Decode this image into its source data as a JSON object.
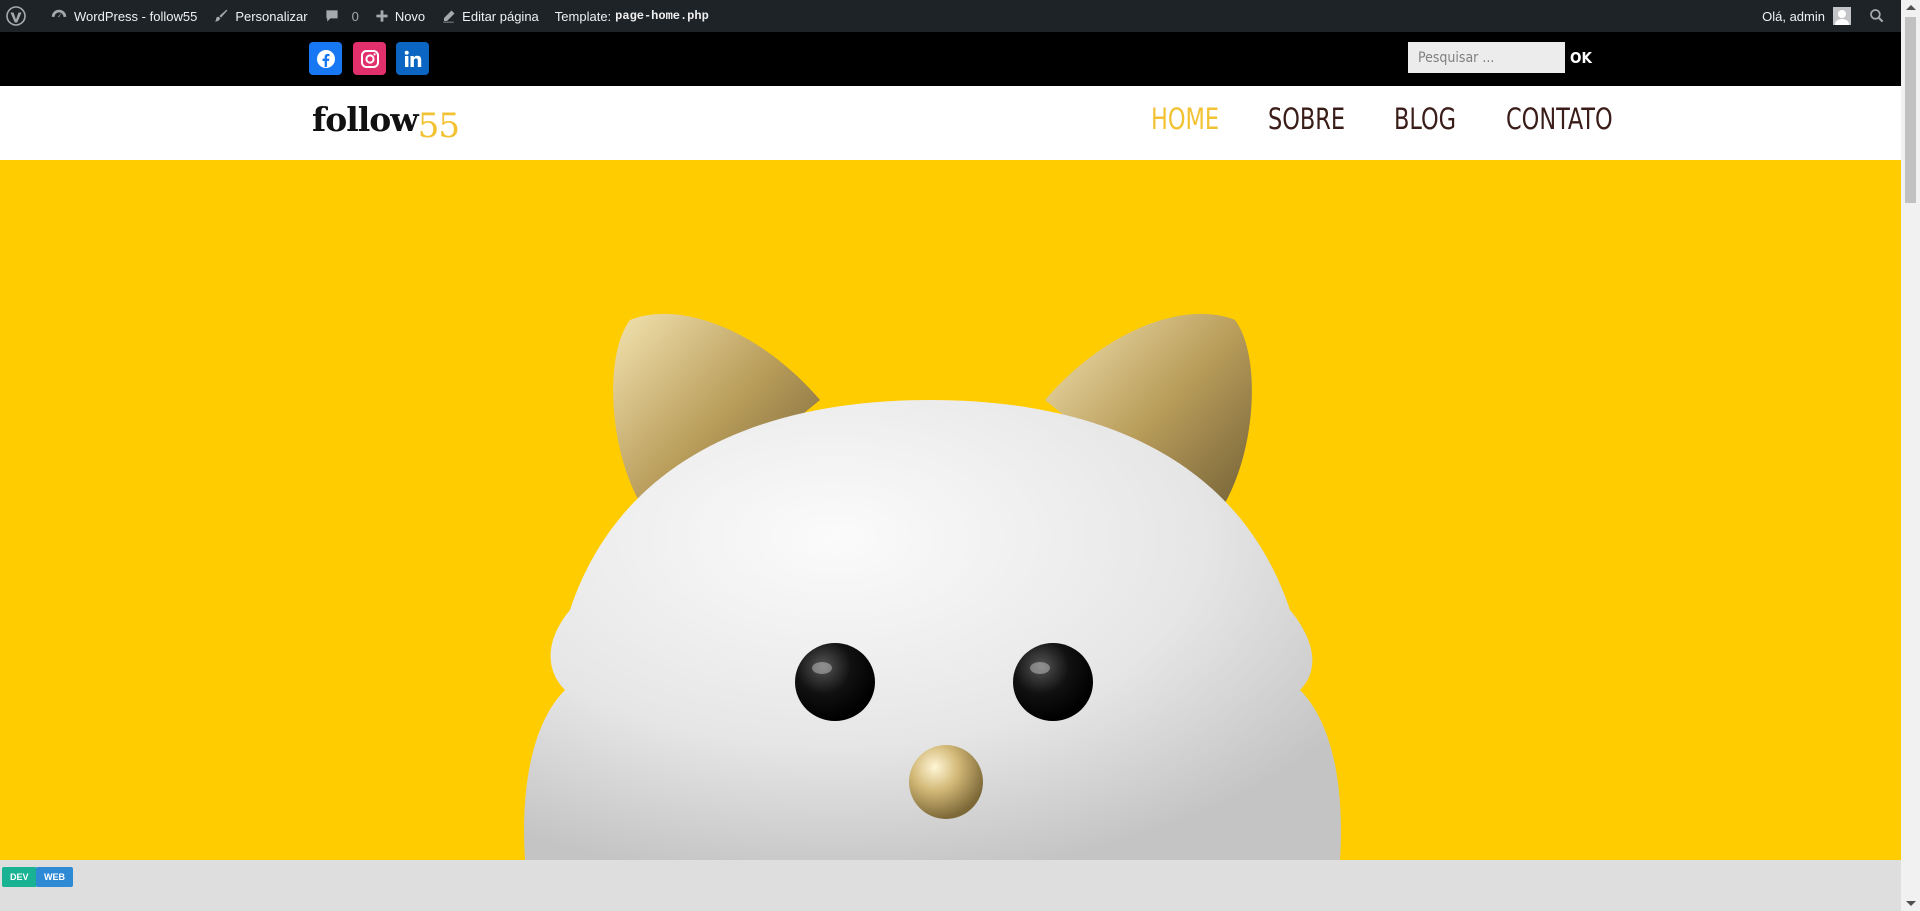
{
  "admin_bar": {
    "site_name": "WordPress - follow55",
    "customize": "Personalizar",
    "comments_count": "0",
    "new": "Novo",
    "edit_page": "Editar página",
    "template_label": "Template:",
    "template_file": "page-home.php",
    "greeting": "Olá, admin"
  },
  "social": {
    "facebook_icon": "facebook-icon",
    "instagram_icon": "instagram-icon",
    "linkedin_icon": "linkedin-icon"
  },
  "search": {
    "placeholder": "Pesquisar ...",
    "button": "OK"
  },
  "logo": {
    "text": "follow",
    "number": "55"
  },
  "nav": {
    "items": [
      "HOME",
      "SOBRE",
      "BLOG",
      "CONTATO"
    ],
    "active": "HOME"
  },
  "tags": [
    "DEV",
    "WEB"
  ],
  "colors": {
    "accent": "#ffcc00",
    "nav_text": "#3a1c18",
    "nav_active": "#f2c232",
    "admin_bar": "#1d2327"
  }
}
